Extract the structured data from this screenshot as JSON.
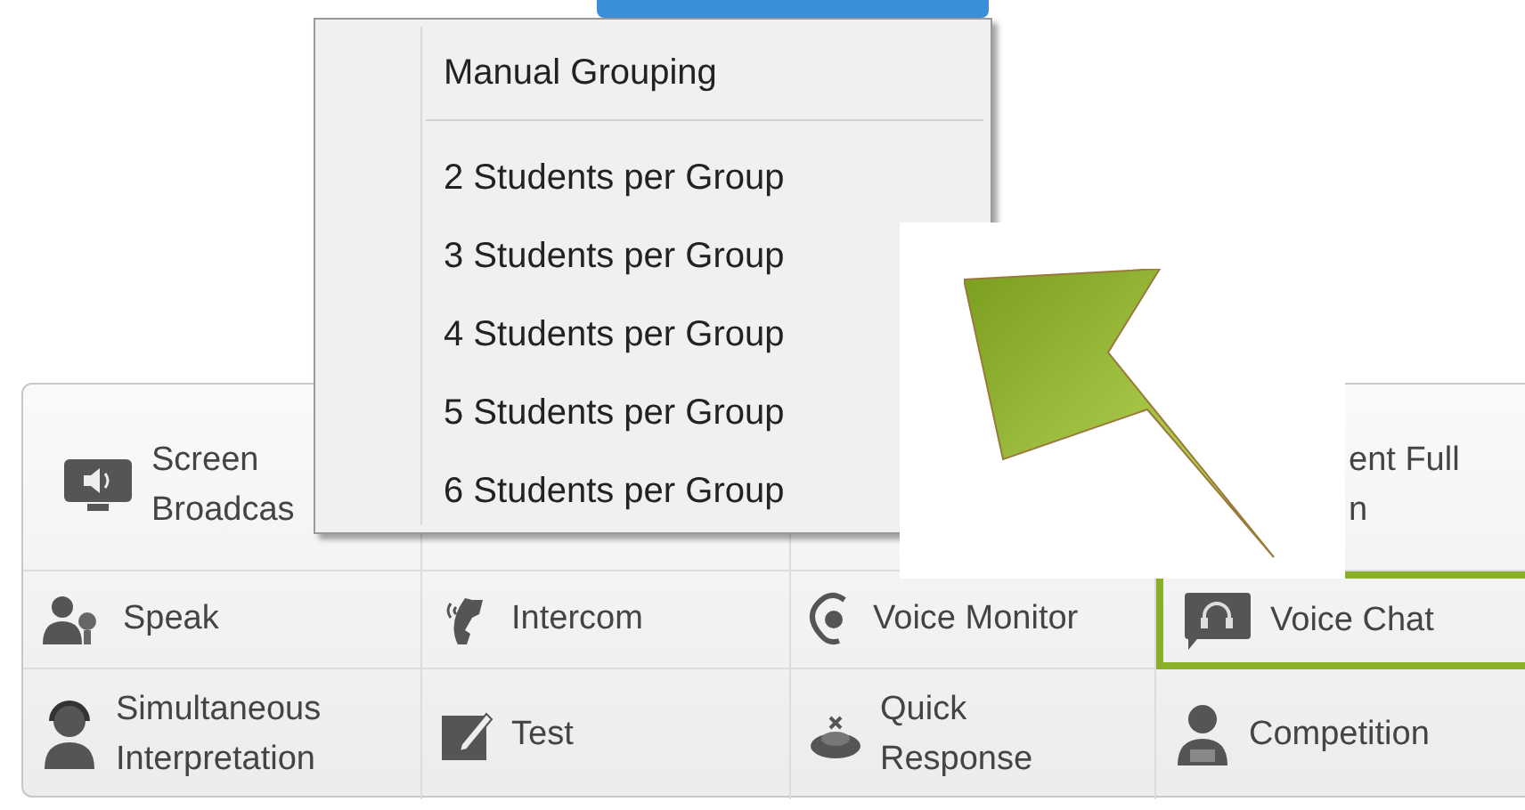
{
  "menu": {
    "items": [
      {
        "label": "Manual Grouping",
        "kind": "header"
      },
      {
        "label": "2 Students per Group",
        "kind": "option"
      },
      {
        "label": "3 Students per Group",
        "kind": "option"
      },
      {
        "label": "4 Students per Group",
        "kind": "option"
      },
      {
        "label": "5 Students per Group",
        "kind": "option"
      },
      {
        "label": "6 Students per Group",
        "kind": "option"
      }
    ]
  },
  "toolbar": {
    "rows": [
      [
        {
          "lines": [
            "Screen",
            "Broadcas"
          ],
          "highlighted": false
        },
        {},
        {},
        {
          "lines": [
            "ent Full",
            "n"
          ],
          "highlighted": false
        }
      ],
      [
        {
          "lines": [
            "Speak"
          ],
          "highlighted": false
        },
        {
          "lines": [
            "Intercom"
          ],
          "highlighted": false
        },
        {
          "lines": [
            "Voice Monitor"
          ],
          "highlighted": false
        },
        {
          "lines": [
            "Voice Chat"
          ],
          "highlighted": true
        }
      ],
      [
        {
          "lines": [
            "Simultaneous",
            "Interpretation"
          ],
          "highlighted": false
        },
        {
          "lines": [
            "Test"
          ],
          "highlighted": false
        },
        {
          "lines": [
            "Quick",
            "Response"
          ],
          "highlighted": false
        },
        {
          "lines": [
            "Competition"
          ],
          "highlighted": false
        }
      ]
    ]
  }
}
